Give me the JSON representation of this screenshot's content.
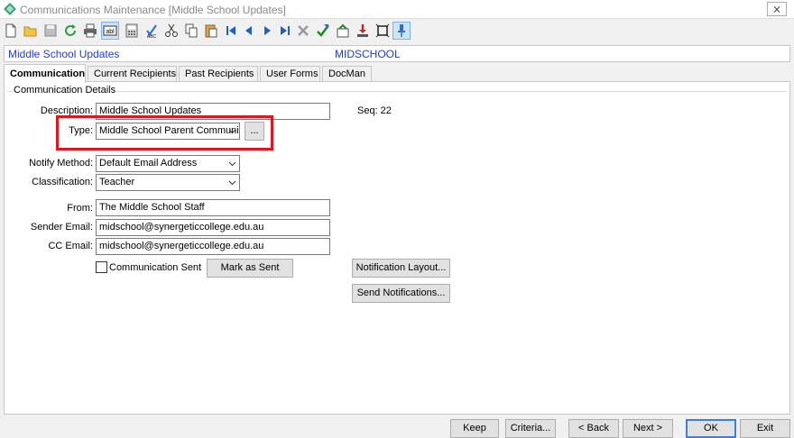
{
  "window": {
    "title": "Communications Maintenance  [Middle School Updates]",
    "close_label": "⨯"
  },
  "toolbar": {
    "icons": [
      "new-icon",
      "open-folder-icon",
      "save-icon",
      "refresh-icon",
      "print-icon",
      "abl-icon",
      "calculator-icon",
      "spellcheck-icon",
      "cut-icon",
      "copy-icon",
      "paste-icon",
      "first-record-icon",
      "previous-record-icon",
      "next-record-icon",
      "last-record-icon",
      "delete-icon",
      "tick-icon",
      "approve-icon",
      "download-icon",
      "fit-icon",
      "pin-icon"
    ],
    "abl_label": "abl"
  },
  "record": {
    "name": "Middle School Updates",
    "code": "MIDSCHOOL"
  },
  "tabs": [
    {
      "label": "Communication"
    },
    {
      "label": "Current Recipients"
    },
    {
      "label": "Past Recipients"
    },
    {
      "label": "User Forms"
    },
    {
      "label": "DocMan"
    }
  ],
  "details": {
    "group_title": "Communication Details",
    "description_label": "Description:",
    "description_value": "Middle School Updates",
    "seq_text": "Seq: 22",
    "type_label": "Type:",
    "type_value": "Middle School Parent Communica",
    "type_browse_label": "...",
    "notify_label": "Notify Method:",
    "notify_value": "Default Email Address",
    "classification_label": "Classification:",
    "classification_value": "Teacher",
    "from_label": "From:",
    "from_value": "The Middle School Staff",
    "sender_label": "Sender Email:",
    "sender_value": "midschool@synergeticcollege.edu.au",
    "cc_label": "CC Email:",
    "cc_value": "midschool@synergeticcollege.edu.au",
    "sent_label": "Communication Sent",
    "sent_checked": false,
    "mark_sent_label": "Mark as Sent",
    "notification_layout_label": "Notification Layout...",
    "send_notifications_label": "Send  Notifications..."
  },
  "footer": {
    "keep": "Keep",
    "criteria": "Criteria...",
    "back": "< Back",
    "next": "Next >",
    "ok": "OK",
    "exit": "Exit"
  },
  "colors": {
    "record_text": "#1f3fd0",
    "highlight": "#e0161e",
    "default_button_border": "#3c7fd6"
  }
}
